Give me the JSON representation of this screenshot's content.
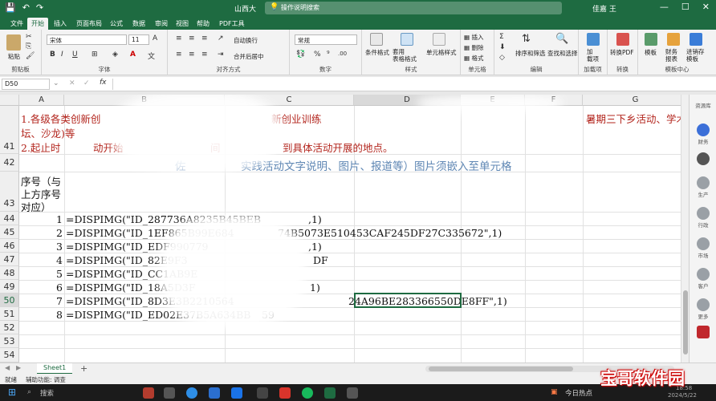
{
  "titlebar": {
    "title": "山西大",
    "search_hint": "操作说明搜索",
    "user": "佳嘉 王",
    "controls": [
      "—",
      "☐",
      "✕"
    ]
  },
  "tabs": [
    "文件",
    "开始",
    "插入",
    "页面布局",
    "公式",
    "数据",
    "审阅",
    "视图",
    "帮助",
    "PDF工具"
  ],
  "active_tab": "开始",
  "ribbon": {
    "clipboard": {
      "label": "剪贴板",
      "paste": "粘贴"
    },
    "font": {
      "label": "字体",
      "name": "宋体",
      "size": "11"
    },
    "align": {
      "label": "对齐方式",
      "wrap": "自动换行",
      "merge": "合并后居中"
    },
    "number": {
      "label": "数字",
      "format": "常规"
    },
    "styles": {
      "label": "样式",
      "cond": "条件格式",
      "table": "套用\n表格格式",
      "cell": "单元格样式"
    },
    "cells": {
      "label": "单元格",
      "insert": "插入",
      "delete": "删除",
      "format": "格式"
    },
    "editing": {
      "label": "编辑",
      "sort": "排序和筛选",
      "find": "查找和选择"
    },
    "addins": {
      "label": "加载项",
      "btn": "加\n载项"
    },
    "convert": {
      "label": "转换",
      "btn": "转换PDF"
    },
    "template": {
      "label": "模板中心",
      "b1": "模板",
      "b2": "财务\n报表",
      "b3": "进销存\n模板"
    }
  },
  "formula_bar": {
    "namebox": "D50",
    "fx": "fx"
  },
  "columns": [
    {
      "name": "A",
      "selected": false
    },
    {
      "name": "B",
      "selected": false
    },
    {
      "name": "C",
      "selected": false
    },
    {
      "name": "D",
      "selected": true
    },
    {
      "name": "E",
      "selected": false
    },
    {
      "name": "F",
      "selected": false
    },
    {
      "name": "G",
      "selected": false
    }
  ],
  "rows": {
    "r41": "41",
    "r42": "42",
    "r43": "43",
    "r44": "44",
    "r45": "45",
    "r46": "46",
    "r47": "47",
    "r48": "48",
    "r49": "49",
    "r50": "50",
    "r51": "51",
    "r52": "52",
    "r53": "53",
    "r54": "54"
  },
  "cells": {
    "line1a": "1.各级各类创新创",
    "line1b": "新创业训练",
    "line1c": "暑期三下乡活动、学术",
    "line1d": "坛、沙龙)等",
    "line2a": "2.起止时",
    "line2b": "动开始",
    "line2c": "间",
    "line2d": "到具体活动开展的地点。",
    "r42a": "佐",
    "r42b": "实践活动文字说明、图片、报道等）图片须嵌入至单元格",
    "seq_header": [
      "序号（与",
      "上方序号",
      "对应）"
    ],
    "data": [
      {
        "num": "1",
        "left": "=DISPIMG(\"ID_287736A8235B45BEB",
        "right": ",1)"
      },
      {
        "num": "2",
        "left": "=DISPIMG(\"ID_1EF865B99E684",
        "right": "74B5073E510453CAF245DF27C335672\",1)"
      },
      {
        "num": "3",
        "left": "=DISPIMG(\"ID_EDF990779",
        "right": ",1)"
      },
      {
        "num": "4",
        "left": "=DISPIMG(\"ID_82E9F3",
        "right": "DF"
      },
      {
        "num": "5",
        "left": "=DISPIMG(\"ID_CC1AB9E",
        "right": ""
      },
      {
        "num": "6",
        "left": "=DISPIMG(\"ID_18A5D3F",
        "right": "1)"
      },
      {
        "num": "7",
        "left": "=DISPIMG(\"ID_8D3E3B2210564",
        "right": "24A96BE283366550DE8FF\",1)"
      },
      {
        "num": "8",
        "left": "=DISPIMG(\"ID_ED02E37B5A634BB",
        "right": "59"
      }
    ]
  },
  "sheet": {
    "name": "Sheet1",
    "add": "+"
  },
  "status": {
    "ready": "就绪",
    "accessibility": "辅助功能: 调查"
  },
  "right_pane": {
    "title": "资源库",
    "items": [
      "财务",
      "",
      "生产",
      "行政",
      "市场",
      "客户",
      "更多"
    ]
  },
  "taskbar": {
    "search": "搜索",
    "news": "今日热点",
    "time": "18:58",
    "date": "2024/5/22"
  },
  "watermark": "宝哥软件园"
}
